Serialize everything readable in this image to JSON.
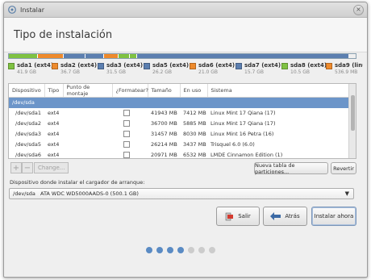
{
  "window": {
    "title": "Instalar",
    "close_glyph": "×"
  },
  "header": {
    "title": "Tipo de instalación"
  },
  "partition_bar": [
    {
      "name": "sda1",
      "fraction": 0.084,
      "color": "#7fc242"
    },
    {
      "name": "sda2",
      "fraction": 0.074,
      "color": "#ee8a2c"
    },
    {
      "name": "sda3",
      "fraction": 0.063,
      "color": "#5c7fb0"
    },
    {
      "name": "sda5",
      "fraction": 0.053,
      "color": "#5c7fb0"
    },
    {
      "name": "sda6",
      "fraction": 0.042,
      "color": "#ee8a2c"
    },
    {
      "name": "sda7",
      "fraction": 0.032,
      "color": "#7fc242"
    },
    {
      "name": "sda8",
      "fraction": 0.021,
      "color": "#7fc242"
    },
    {
      "name": "free",
      "fraction": 0.611,
      "color": "#5c7fb0"
    }
  ],
  "legend": [
    {
      "name": "sda1 (ext4)",
      "size": "41.9 GB",
      "color": "#7fc242"
    },
    {
      "name": "sda2 (ext4)",
      "size": "36.7 GB",
      "color": "#ee8a2c"
    },
    {
      "name": "sda3 (ext4)",
      "size": "31.5 GB",
      "color": "#5c7fb0"
    },
    {
      "name": "sda5 (ext4)",
      "size": "26.2 GB",
      "color": "#5c7fb0"
    },
    {
      "name": "sda6 (ext4)",
      "size": "21.0 GB",
      "color": "#ee8a2c"
    },
    {
      "name": "sda7 (ext4)",
      "size": "15.7 GB",
      "color": "#5c7fb0"
    },
    {
      "name": "sda8 (ext4)",
      "size": "10.5 GB",
      "color": "#7fc242"
    },
    {
      "name": "sda9 (linux-swap)",
      "size": "536.9 MB",
      "color": "#ee8a2c"
    }
  ],
  "table": {
    "columns": [
      "Dispositivo",
      "Tipo",
      "Punto de montaje",
      "¿Formatear?",
      "Tamaño",
      "En uso",
      "Sistema"
    ],
    "group_label": "/dev/sda",
    "rows": [
      {
        "device": "/dev/sda1",
        "type": "ext4",
        "mount": "",
        "size": "41943 MB",
        "used": "7412 MB",
        "system": "Linux Mint 17 Qiana (17)"
      },
      {
        "device": "/dev/sda2",
        "type": "ext4",
        "mount": "",
        "size": "36700 MB",
        "used": "5885 MB",
        "system": "Linux Mint 17 Qiana (17)"
      },
      {
        "device": "/dev/sda3",
        "type": "ext4",
        "mount": "",
        "size": "31457 MB",
        "used": "8030 MB",
        "system": "Linux Mint 16 Petra (16)"
      },
      {
        "device": "/dev/sda5",
        "type": "ext4",
        "mount": "",
        "size": "26214 MB",
        "used": "3437 MB",
        "system": "Trisquel 6.0 (6.0)"
      },
      {
        "device": "/dev/sda6",
        "type": "ext4",
        "mount": "",
        "size": "20971 MB",
        "used": "6532 MB",
        "system": "LMDE Cinnamon Edition (1)"
      }
    ]
  },
  "toolbar": {
    "add_glyph": "+",
    "remove_glyph": "−",
    "change_label": "Change...",
    "new_table_label": "Nueva tabla de particiones...",
    "revert_label": "Revertir"
  },
  "bootloader": {
    "label": "Dispositivo donde instalar el cargador de arranque:",
    "device": "/dev/sda",
    "description": "ATA WDC WD5000AADS-0 (500.1 GB)",
    "arrow": "▼"
  },
  "actions": {
    "quit_label": "Salir",
    "back_label": "Atrás",
    "install_label": "Instalar ahora"
  },
  "progress": {
    "total_steps": 7,
    "completed_steps": 4,
    "active_color": "#5a8bc4",
    "inactive_color": "#cccccc"
  }
}
